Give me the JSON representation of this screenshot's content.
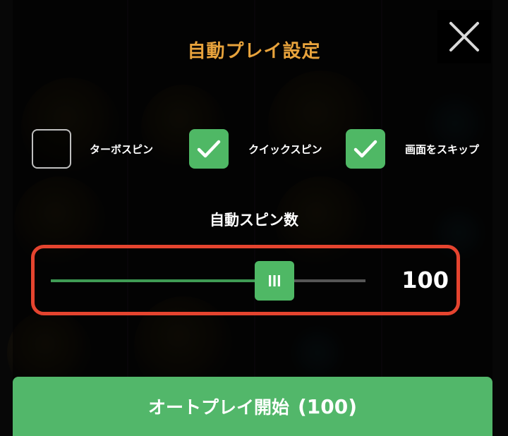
{
  "dialog": {
    "title": "自動プレイ設定",
    "close_icon": "close-icon"
  },
  "options": [
    {
      "label": "ターボスピン",
      "checked": false
    },
    {
      "label": "クイックスピン",
      "checked": true
    },
    {
      "label": "画面をスキップ",
      "checked": true
    }
  ],
  "spins": {
    "heading": "自動スピン数",
    "value": "100",
    "slider_fraction": 0.71,
    "thumb_icon": "grip-lines-icon"
  },
  "start_button": {
    "label": "オートプレイ開始",
    "count": "(100)"
  },
  "colors": {
    "accent_green": "#52b76a",
    "title_orange": "#e8a33c",
    "highlight_red": "#e5442f"
  }
}
